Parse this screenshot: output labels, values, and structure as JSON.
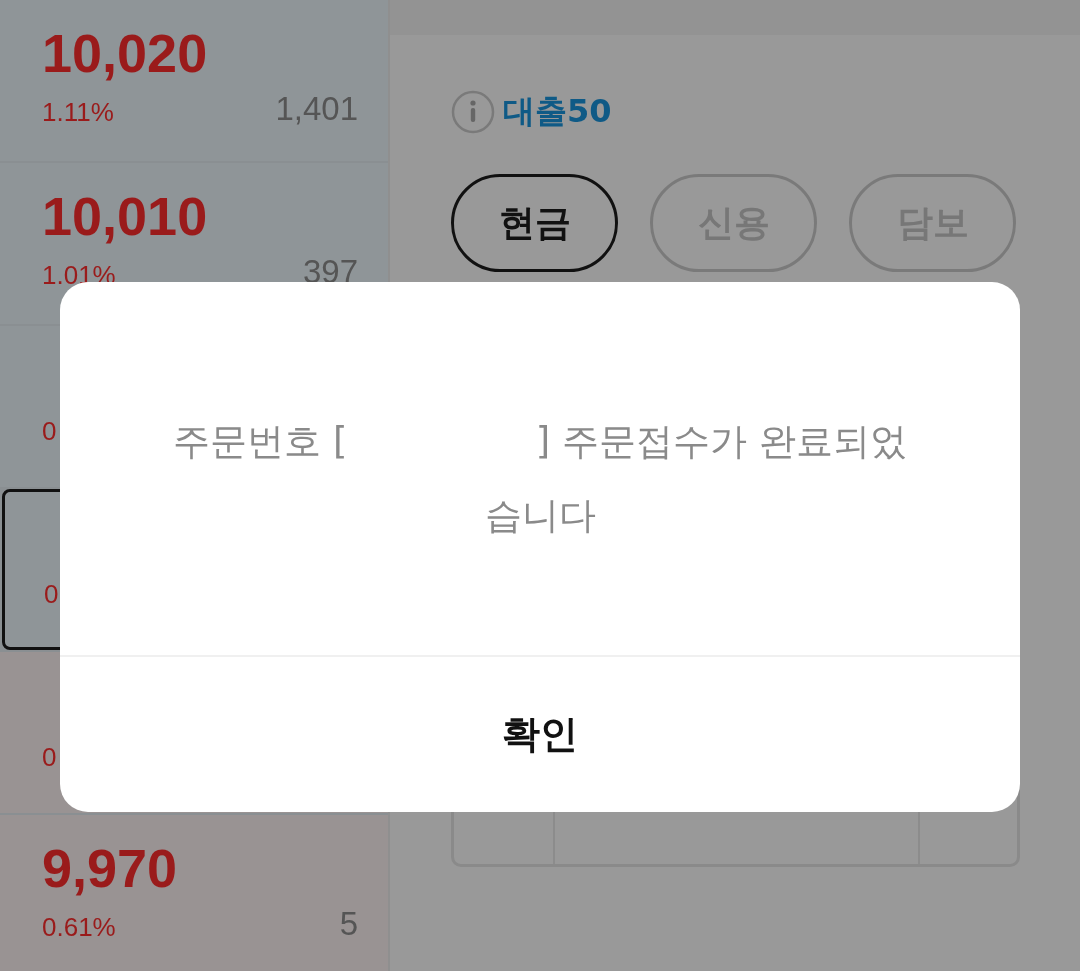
{
  "order_book": [
    {
      "kind": "ask",
      "price": "10,020",
      "change": "1.11%",
      "volume": "1,401",
      "selected": false
    },
    {
      "kind": "ask",
      "price": "10,010",
      "change": "1.01%",
      "volume": "397",
      "selected": false
    },
    {
      "kind": "ask",
      "change": "0",
      "selected": false
    },
    {
      "kind": "ask",
      "change": "0",
      "selected": true
    },
    {
      "kind": "bid",
      "change": "0",
      "selected": false
    },
    {
      "kind": "bid",
      "price": "9,970",
      "change": "0.61%",
      "volume": "5",
      "selected": false
    }
  ],
  "margin_info": {
    "label": "대출50"
  },
  "account_types": [
    {
      "label": "현금",
      "selected": true
    },
    {
      "label": "신용",
      "selected": false
    },
    {
      "label": "담보",
      "selected": false
    }
  ],
  "dialog": {
    "message": "주문번호 [                ] 주문접수가 완료되었습니다",
    "confirm": "확인"
  }
}
